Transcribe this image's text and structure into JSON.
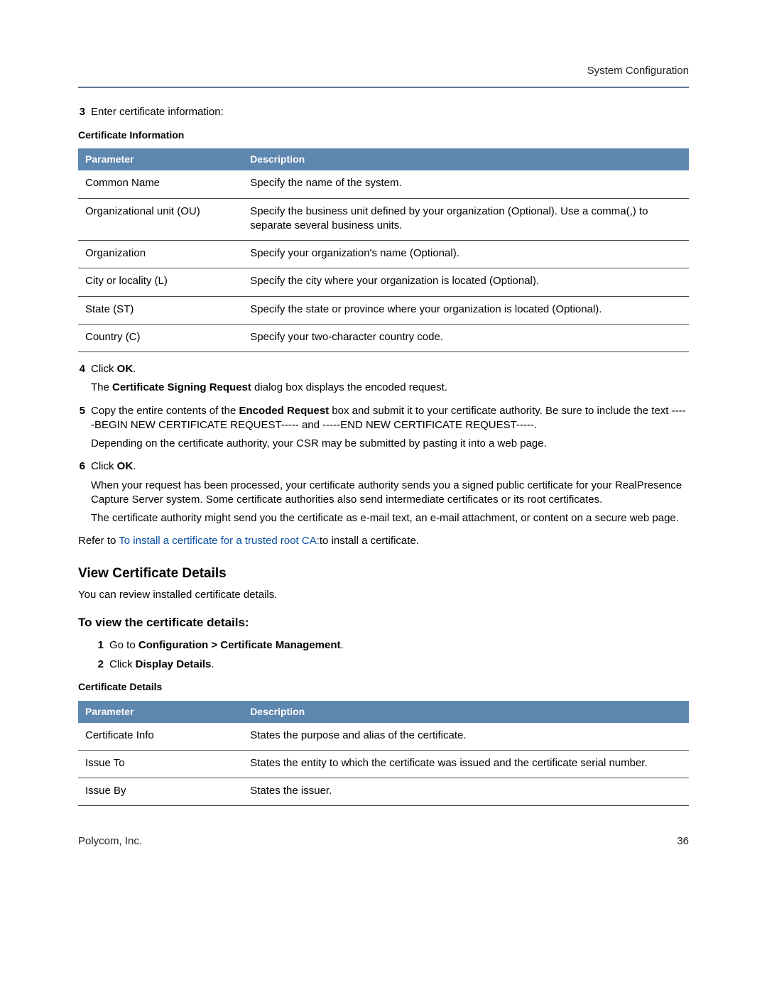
{
  "header": {
    "right": "System Configuration"
  },
  "steps_a": {
    "s3": {
      "num": "3",
      "text": "Enter certificate information:"
    },
    "s4": {
      "num": "4",
      "p1_pre": "Click ",
      "p1_bold": "OK",
      "p1_post": ".",
      "p2_pre": "The ",
      "p2_bold": "Certificate Signing Request",
      "p2_post": " dialog box displays the encoded request."
    },
    "s5": {
      "num": "5",
      "p1_pre": "Copy the entire contents of the ",
      "p1_bold": "Encoded Request",
      "p1_post": " box and submit it to your certificate authority. Be sure to include the text -----BEGIN NEW CERTIFICATE REQUEST----- and -----END NEW CERTIFICATE REQUEST-----.",
      "p2": "Depending on the certificate authority, your CSR may be submitted by pasting it into a web page."
    },
    "s6": {
      "num": "6",
      "p1_pre": "Click ",
      "p1_bold": "OK",
      "p1_post": ".",
      "p2": "When your request has been processed, your certificate authority sends you a signed public certificate for your RealPresence Capture Server system. Some certificate authorities also send intermediate certificates or its root certificates.",
      "p3": "The certificate authority might send you the certificate as e-mail text, an e-mail attachment, or content on a secure web page."
    }
  },
  "table1": {
    "caption": "Certificate Information",
    "h1": "Parameter",
    "h2": "Description",
    "rows": [
      {
        "p": "Common Name",
        "d": "Specify the name of the system."
      },
      {
        "p": "Organizational unit (OU)",
        "d": "Specify the business unit defined by your organization (Optional). Use a comma(,) to separate several business units."
      },
      {
        "p": "Organization",
        "d": "Specify your organization's name (Optional)."
      },
      {
        "p": "City or locality (L)",
        "d": "Specify the city where your organization is located (Optional)."
      },
      {
        "p": "State (ST)",
        "d": "Specify the state or province where your organization is located (Optional)."
      },
      {
        "p": "Country (C)",
        "d": "Specify your two-character country code."
      }
    ]
  },
  "refer": {
    "pre": "Refer to ",
    "link": "To install a certificate for a trusted root CA:",
    "post": "to install a certificate."
  },
  "section_view": {
    "title": "View Certificate Details",
    "intro": "You can review installed certificate details.",
    "procedure_title": "To view the certificate details:",
    "s1": {
      "num": "1",
      "pre": "Go to ",
      "bold": "Configuration > Certificate Management",
      "post": "."
    },
    "s2": {
      "num": "2",
      "pre": "Click ",
      "bold": "Display Details",
      "post": "."
    }
  },
  "table2": {
    "caption": "Certificate Details",
    "h1": "Parameter",
    "h2": "Description",
    "rows": [
      {
        "p": "Certificate Info",
        "d": "States the purpose and alias of the certificate."
      },
      {
        "p": "Issue To",
        "d": "States the entity to which the certificate was issued and the certificate serial number."
      },
      {
        "p": "Issue By",
        "d": "States the issuer."
      }
    ]
  },
  "footer": {
    "left": "Polycom, Inc.",
    "right": "36"
  }
}
